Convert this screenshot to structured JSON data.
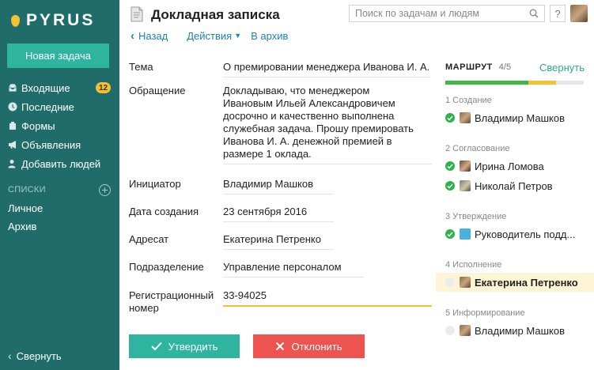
{
  "sidebar": {
    "logo": "PYRUS",
    "new_task": "Новая задача",
    "items": [
      {
        "label": "Входящие",
        "icon": "inbox-icon",
        "badge": "12"
      },
      {
        "label": "Последние",
        "icon": "clock-icon"
      },
      {
        "label": "Формы",
        "icon": "forms-icon"
      },
      {
        "label": "Объявления",
        "icon": "megaphone-icon"
      },
      {
        "label": "Добавить людей",
        "icon": "add-user-icon"
      }
    ],
    "lists_header": "СПИСКИ",
    "lists": [
      "Личное",
      "Архив"
    ],
    "collapse": "Свернуть"
  },
  "header": {
    "title": "Докладная записка",
    "search_placeholder": "Поиск по задачам и людям",
    "help": "?"
  },
  "toolbar": {
    "back": "Назад",
    "actions": "Действия",
    "archive": "В архив"
  },
  "form": {
    "fields": [
      {
        "label": "Тема",
        "value": "О премировании менеджера Иванова И. А."
      },
      {
        "label": "Обращение",
        "value": "Докладываю, что менеджером\nИвановым Ильей Александровичем\nдосрочно и качественно выполнена\nслужебная задача. Прошу премировать\nИванова И. А. денежной премией в\nразмере 1 оклада."
      },
      {
        "label": "Инициатор",
        "value": "Владимир Машков"
      },
      {
        "label": "Дата создания",
        "value": "23 сентября 2016"
      },
      {
        "label": "Адресат",
        "value": "Екатерина Петренко"
      },
      {
        "label": "Подразделение",
        "value": "Управление персоналом"
      },
      {
        "label": "Регистрационный\nномер",
        "value": "33-94025"
      }
    ],
    "approve": "Утвердить",
    "reject": "Отклонить"
  },
  "route": {
    "title": "МАРШРУТ",
    "count": "4/5",
    "collapse": "Свернуть",
    "progress": [
      {
        "fraction": 0.6,
        "color": "#43b649"
      },
      {
        "fraction": 0.2,
        "color": "#f2c230"
      }
    ],
    "stages": [
      {
        "title": "1 Создание",
        "steps": [
          {
            "name": "Владимир Машков",
            "status": "done"
          }
        ]
      },
      {
        "title": "2 Согласование",
        "steps": [
          {
            "name": "Ирина Ломова",
            "status": "done"
          },
          {
            "name": "Николай Петров",
            "status": "done"
          }
        ]
      },
      {
        "title": "3 Утверждение",
        "steps": [
          {
            "name": "Руководитель подд...",
            "status": "done"
          }
        ]
      },
      {
        "title": "4 Исполнение",
        "steps": [
          {
            "name": "Екатерина Петренко",
            "status": "current"
          }
        ]
      },
      {
        "title": "5 Информирование",
        "steps": [
          {
            "name": "Владимир Машков",
            "status": "pending"
          }
        ]
      }
    ]
  },
  "colors": {
    "sidebar": "#206c6a",
    "accent": "#2fb59f",
    "reject": "#ee5350",
    "link": "#1e7fb8",
    "highlight": "#f2c230"
  }
}
